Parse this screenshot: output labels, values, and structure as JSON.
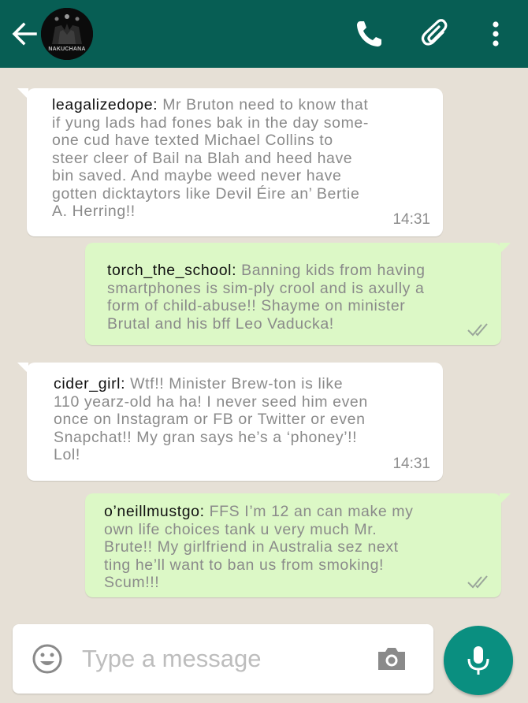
{
  "header": {
    "avatar_text": "NAKUCHANA",
    "icons": {
      "back": "back-arrow-icon",
      "call": "phone-icon",
      "attach": "paperclip-icon",
      "menu": "more-vert-icon"
    },
    "color": "#075e54"
  },
  "messages": [
    {
      "direction": "incoming",
      "user": "leagalizedope:",
      "lines": [
        " Mr Bruton need to know that",
        "if yung lads had fones bak in the day some-",
        "one cud have texted Michael Collins to",
        "steer cleer of Bail na Blah and heed have",
        "bin saved. And maybe weed never have",
        "gotten dicktaytors like Devil Éire an’ Bertie",
        "A. Herring!!"
      ],
      "time": "14:31"
    },
    {
      "direction": "outgoing",
      "user": "torch_the_school:",
      "lines": [
        " Banning kids from having",
        "smartphones is sim-ply crool and is axully a",
        "form of child-abuse!! Shayme on minister",
        "Brutal and his bff Leo Vaducka!"
      ],
      "status_icon": "double-check-icon"
    },
    {
      "direction": "incoming",
      "user": "cider_girl:",
      "lines": [
        " Wtf!! Minister Brew-ton is like",
        "110 yearz-old ha ha! I never seed him even",
        "once on Instagram or FB or Twitter or even",
        "Snapchat!! My gran says he’s a ‘phoney’!!",
        "Lol!"
      ],
      "time": "14:31"
    },
    {
      "direction": "outgoing",
      "user": "o’neillmustgo:",
      "lines": [
        " FFS I’m 12 an can make my",
        "own life choices tank u very much Mr.",
        "Brute!!  My girlfriend in Australia sez next",
        "ting he’ll want to ban us from smoking!",
        "Scum!!!"
      ],
      "status_icon": "double-check-icon"
    }
  ],
  "composer": {
    "placeholder": "Type a message",
    "icons": {
      "emoji": "emoji-icon",
      "camera": "camera-icon",
      "mic": "microphone-icon"
    }
  },
  "colors": {
    "incoming_bubble": "#ffffff",
    "outgoing_bubble": "#dcf8c6",
    "mic_button": "#0a8f80",
    "chat_background": "#e6e0d6"
  }
}
